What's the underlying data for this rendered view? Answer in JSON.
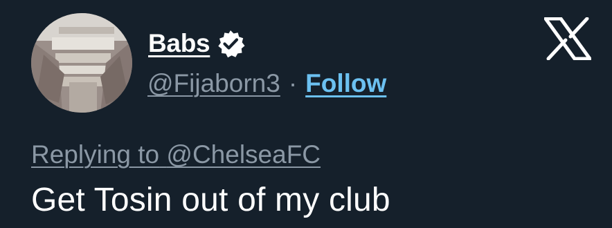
{
  "author": {
    "display_name": "Babs",
    "handle": "@Fijaborn3",
    "separator": "·",
    "follow_label": "Follow",
    "verified": true
  },
  "reply": {
    "prefix": "Replying to",
    "mention": "@ChelseaFC"
  },
  "tweet": {
    "text": "Get Tosin out of my club"
  },
  "icons": {
    "brand": "x-logo-icon",
    "badge": "verified-badge-icon"
  },
  "colors": {
    "background": "#15202b",
    "text_primary": "#ffffff",
    "text_secondary": "#8b98a5",
    "link": "#6cc1f1"
  }
}
